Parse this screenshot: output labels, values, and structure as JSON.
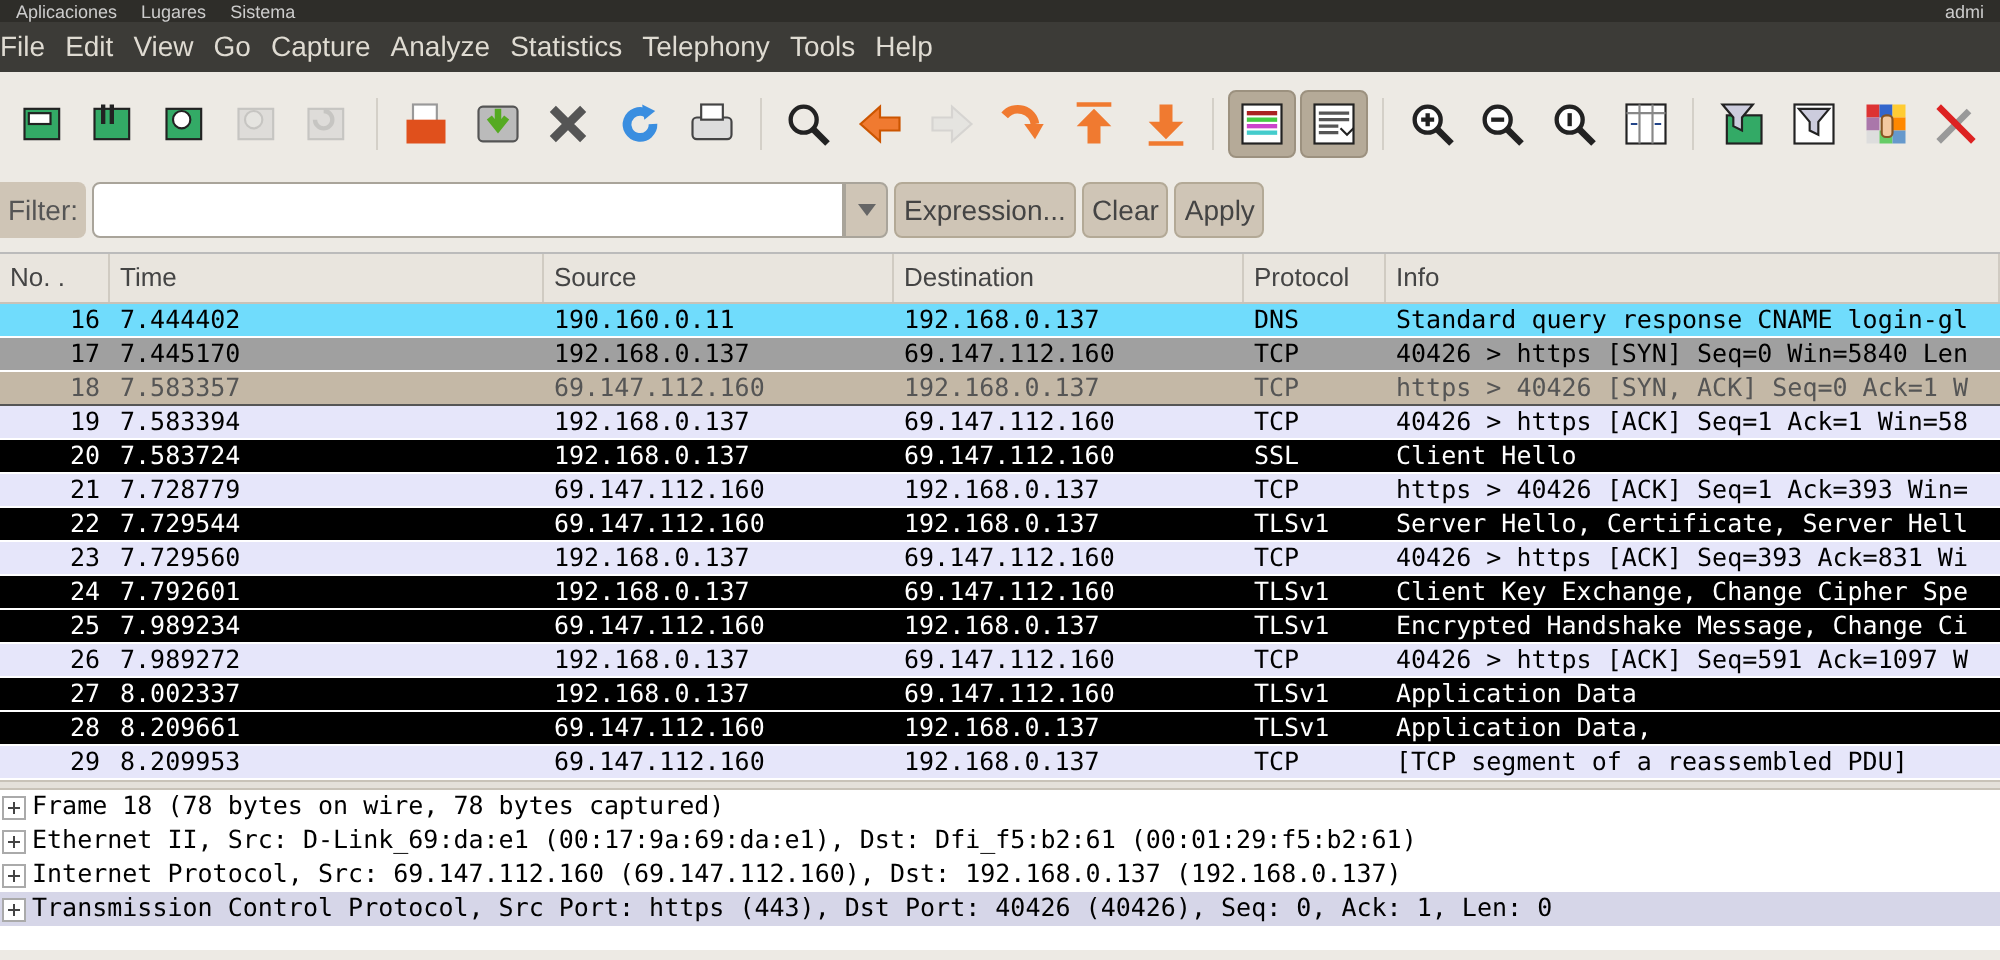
{
  "top_panel": {
    "items": [
      "Aplicaciones",
      "Lugares",
      "Sistema"
    ],
    "user": "admi"
  },
  "menu": [
    "File",
    "Edit",
    "View",
    "Go",
    "Capture",
    "Analyze",
    "Statistics",
    "Telephony",
    "Tools",
    "Help"
  ],
  "toolbar": [
    {
      "kind": "interfaces",
      "disabled": false,
      "pressed": false
    },
    {
      "kind": "options",
      "disabled": false,
      "pressed": false
    },
    {
      "kind": "start",
      "disabled": false,
      "pressed": false
    },
    {
      "kind": "stop",
      "disabled": true,
      "pressed": false
    },
    {
      "kind": "restart",
      "disabled": true,
      "pressed": false
    },
    {
      "kind": "sep"
    },
    {
      "kind": "open",
      "disabled": false,
      "pressed": false
    },
    {
      "kind": "save",
      "disabled": false,
      "pressed": false
    },
    {
      "kind": "close",
      "disabled": false,
      "pressed": false
    },
    {
      "kind": "reload",
      "disabled": false,
      "pressed": false
    },
    {
      "kind": "print",
      "disabled": false,
      "pressed": false
    },
    {
      "kind": "sep"
    },
    {
      "kind": "find",
      "disabled": false,
      "pressed": false
    },
    {
      "kind": "back",
      "disabled": false,
      "pressed": false
    },
    {
      "kind": "forward",
      "disabled": true,
      "pressed": false
    },
    {
      "kind": "goto",
      "disabled": false,
      "pressed": false
    },
    {
      "kind": "first",
      "disabled": false,
      "pressed": false
    },
    {
      "kind": "last",
      "disabled": false,
      "pressed": false
    },
    {
      "kind": "sep"
    },
    {
      "kind": "colorize",
      "disabled": false,
      "pressed": true
    },
    {
      "kind": "autoscroll",
      "disabled": false,
      "pressed": true
    },
    {
      "kind": "sep"
    },
    {
      "kind": "zoomin",
      "disabled": false,
      "pressed": false
    },
    {
      "kind": "zoomout",
      "disabled": false,
      "pressed": false
    },
    {
      "kind": "zoomreset",
      "disabled": false,
      "pressed": false
    },
    {
      "kind": "resize",
      "disabled": false,
      "pressed": false
    },
    {
      "kind": "sep"
    },
    {
      "kind": "capfilter",
      "disabled": false,
      "pressed": false
    },
    {
      "kind": "dispfilter",
      "disabled": false,
      "pressed": false
    },
    {
      "kind": "colors",
      "disabled": false,
      "pressed": false
    },
    {
      "kind": "prefs",
      "disabled": false,
      "pressed": false
    }
  ],
  "filter": {
    "label": "Filter:",
    "buttons": [
      "Expression...",
      "Clear",
      "Apply"
    ]
  },
  "table": {
    "columns": [
      "No. .",
      "Time",
      "Source",
      "Destination",
      "Protocol",
      "Info"
    ],
    "rows": [
      {
        "cells": [
          "16",
          "7.444402",
          "190.160.0.11",
          "192.168.0.137",
          "DNS",
          "Standard query response CNAME login-gl"
        ],
        "color": "#70dcfc",
        "selected": false
      },
      {
        "cells": [
          "17",
          "7.445170",
          "192.168.0.137",
          "69.147.112.160",
          "TCP",
          "40426 > https [SYN] Seq=0 Win=5840 Len"
        ],
        "color": "#a0a0a0",
        "selected": false
      },
      {
        "cells": [
          "18",
          "7.583357",
          "69.147.112.160",
          "192.168.0.137",
          "TCP",
          "https > 40426 [SYN, ACK] Seq=0 Ack=1 W"
        ],
        "color": "#c4b8a6",
        "selected": true
      },
      {
        "cells": [
          "19",
          "7.583394",
          "192.168.0.137",
          "69.147.112.160",
          "TCP",
          "40426 > https [ACK] Seq=1 Ack=1 Win=58"
        ],
        "color": "#e6e6fa",
        "selected": false
      },
      {
        "cells": [
          "20",
          "7.583724",
          "192.168.0.137",
          "69.147.112.160",
          "SSL",
          "Client Hello"
        ],
        "color": "#000000",
        "selected": false
      },
      {
        "cells": [
          "21",
          "7.728779",
          "69.147.112.160",
          "192.168.0.137",
          "TCP",
          "https > 40426 [ACK] Seq=1 Ack=393 Win="
        ],
        "color": "#e6e6fa",
        "selected": false
      },
      {
        "cells": [
          "22",
          "7.729544",
          "69.147.112.160",
          "192.168.0.137",
          "TLSv1",
          "Server Hello, Certificate, Server Hell"
        ],
        "color": "#000000",
        "selected": false
      },
      {
        "cells": [
          "23",
          "7.729560",
          "192.168.0.137",
          "69.147.112.160",
          "TCP",
          "40426 > https [ACK] Seq=393 Ack=831 Wi"
        ],
        "color": "#e6e6fa",
        "selected": false
      },
      {
        "cells": [
          "24",
          "7.792601",
          "192.168.0.137",
          "69.147.112.160",
          "TLSv1",
          "Client Key Exchange, Change Cipher Spe"
        ],
        "color": "#000000",
        "selected": false
      },
      {
        "cells": [
          "25",
          "7.989234",
          "69.147.112.160",
          "192.168.0.137",
          "TLSv1",
          "Encrypted Handshake Message, Change Ci"
        ],
        "color": "#000000",
        "selected": false
      },
      {
        "cells": [
          "26",
          "7.989272",
          "192.168.0.137",
          "69.147.112.160",
          "TCP",
          "40426 > https [ACK] Seq=591 Ack=1097 W"
        ],
        "color": "#e6e6fa",
        "selected": false
      },
      {
        "cells": [
          "27",
          "8.002337",
          "192.168.0.137",
          "69.147.112.160",
          "TLSv1",
          "Application Data"
        ],
        "color": "#000000",
        "selected": false
      },
      {
        "cells": [
          "28",
          "8.209661",
          "69.147.112.160",
          "192.168.0.137",
          "TLSv1",
          "Application Data,"
        ],
        "color": "#000000",
        "selected": false
      },
      {
        "cells": [
          "29",
          "8.209953",
          "69.147.112.160",
          "192.168.0.137",
          "TCP",
          "[TCP segment of a reassembled PDU]"
        ],
        "color": "#e6e6fa",
        "selected": false
      }
    ]
  },
  "details": [
    {
      "text": "Frame 18 (78 bytes on wire, 78 bytes captured)",
      "expanded": false,
      "selected": false
    },
    {
      "text": "Ethernet II, Src: D-Link_69:da:e1 (00:17:9a:69:da:e1), Dst: Dfi_f5:b2:61 (00:01:29:f5:b2:61)",
      "expanded": false,
      "selected": false
    },
    {
      "text": "Internet Protocol, Src: 69.147.112.160 (69.147.112.160), Dst: 192.168.0.137 (192.168.0.137)",
      "expanded": false,
      "selected": false
    },
    {
      "text": "Transmission Control Protocol, Src Port: https (443), Dst Port: 40426 (40426), Seq: 0, Ack: 1, Len: 0",
      "expanded": false,
      "selected": true
    }
  ]
}
